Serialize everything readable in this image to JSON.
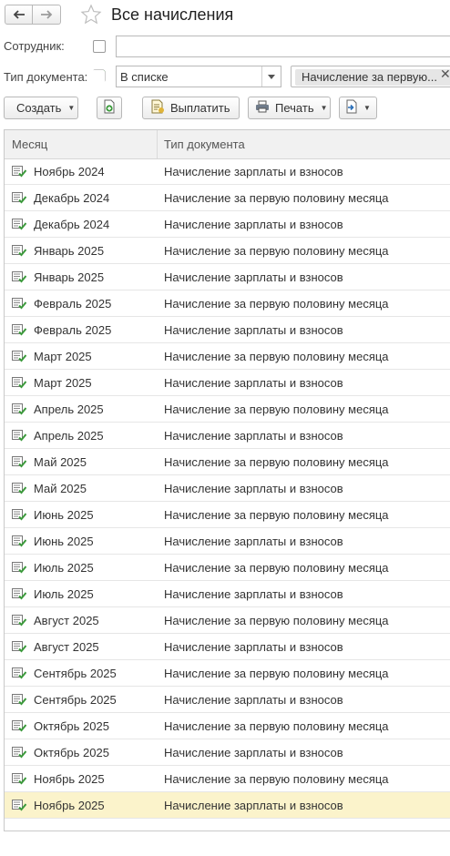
{
  "header": {
    "title": "Все начисления"
  },
  "filters": {
    "employee_label": "Сотрудник:",
    "employee_value": "",
    "doc_type_label": "Тип документа:",
    "doc_type_mode": "В списке",
    "doc_type_value": "Начисление за первую...",
    "doc_type_checked": true
  },
  "toolbar": {
    "create_label": "Создать",
    "pay_label": "Выплатить",
    "print_label": "Печать"
  },
  "table": {
    "columns": [
      "Месяц",
      "Тип документа"
    ],
    "rows": [
      {
        "month": "Ноябрь 2024",
        "type": "Начисление зарплаты и взносов"
      },
      {
        "month": "Декабрь 2024",
        "type": "Начисление за первую половину месяца"
      },
      {
        "month": "Декабрь 2024",
        "type": "Начисление зарплаты и взносов"
      },
      {
        "month": "Январь 2025",
        "type": "Начисление за первую половину месяца"
      },
      {
        "month": "Январь 2025",
        "type": "Начисление зарплаты и взносов"
      },
      {
        "month": "Февраль 2025",
        "type": "Начисление за первую половину месяца"
      },
      {
        "month": "Февраль 2025",
        "type": "Начисление зарплаты и взносов"
      },
      {
        "month": "Март 2025",
        "type": "Начисление за первую половину месяца"
      },
      {
        "month": "Март 2025",
        "type": "Начисление зарплаты и взносов"
      },
      {
        "month": "Апрель 2025",
        "type": "Начисление за первую половину месяца"
      },
      {
        "month": "Апрель 2025",
        "type": "Начисление зарплаты и взносов"
      },
      {
        "month": "Май 2025",
        "type": "Начисление за первую половину месяца"
      },
      {
        "month": "Май 2025",
        "type": "Начисление зарплаты и взносов"
      },
      {
        "month": "Июнь 2025",
        "type": "Начисление за первую половину месяца"
      },
      {
        "month": "Июнь 2025",
        "type": "Начисление зарплаты и взносов"
      },
      {
        "month": "Июль 2025",
        "type": "Начисление за первую половину месяца"
      },
      {
        "month": "Июль 2025",
        "type": "Начисление зарплаты и взносов"
      },
      {
        "month": "Август 2025",
        "type": "Начисление за первую половину месяца"
      },
      {
        "month": "Август 2025",
        "type": "Начисление зарплаты и взносов"
      },
      {
        "month": "Сентябрь 2025",
        "type": "Начисление за первую половину месяца"
      },
      {
        "month": "Сентябрь 2025",
        "type": "Начисление зарплаты и взносов"
      },
      {
        "month": "Октябрь 2025",
        "type": "Начисление за первую половину месяца"
      },
      {
        "month": "Октябрь 2025",
        "type": "Начисление зарплаты и взносов"
      },
      {
        "month": "Ноябрь 2025",
        "type": "Начисление за первую половину месяца"
      },
      {
        "month": "Ноябрь 2025",
        "type": "Начисление зарплаты и взносов"
      }
    ],
    "selected_row": 24
  },
  "colors": {
    "selected_row_bg": "#fbf3cb",
    "check_green": "#3a9a3a",
    "doc_icon_green": "#3c9a3c"
  },
  "icons": {
    "back": "arrow-left-icon",
    "forward": "arrow-right-icon",
    "favorite": "star-icon",
    "doc_type_checkbox": "checkmark-icon",
    "dropdown": "chevron-down-icon",
    "remove_filter": "close-icon",
    "create_copy": "create-document-icon",
    "pay": "pay-document-icon",
    "print": "printer-icon",
    "related": "related-documents-icon",
    "row": "posted-document-icon"
  }
}
